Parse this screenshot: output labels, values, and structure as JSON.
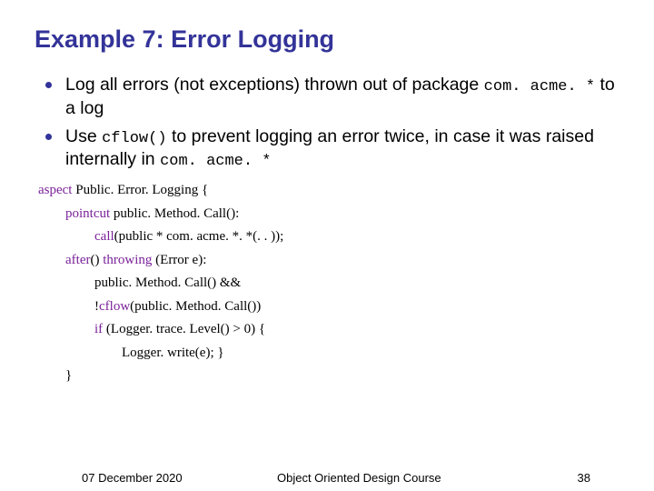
{
  "title": "Example 7: Error Logging",
  "bullets": [
    {
      "prefix": "Log all errors (not exceptions) thrown out of package ",
      "code": "com. acme. *",
      "suffix": " to a log"
    },
    {
      "prefix": "Use ",
      "code1": "cflow()",
      "mid": " to prevent logging an error twice, in case it was raised internally in ",
      "code2": "com. acme. *"
    }
  ],
  "code": {
    "l1a": "aspect",
    "l1b": " Public. Error. Logging {",
    "l2a": "pointcut",
    "l2b": " public. Method. Call():",
    "l3a": "call",
    "l3b": "(public * com. acme. *. *(. . ));",
    "l4a": "after",
    "l4b": "() ",
    "l4c": "throwing",
    "l4d": " (Error e):",
    "l5": "public. Method. Call() &&",
    "l6a": "!",
    "l6b": "cflow",
    "l6c": "(public. Method. Call())",
    "l7a": "if",
    "l7b": " (Logger. trace. Level() > 0) {",
    "l8": "Logger. write(e);   }",
    "l9": "}"
  },
  "footer": {
    "date": "07 December 2020",
    "course": "Object Oriented Design Course",
    "page": "38"
  }
}
